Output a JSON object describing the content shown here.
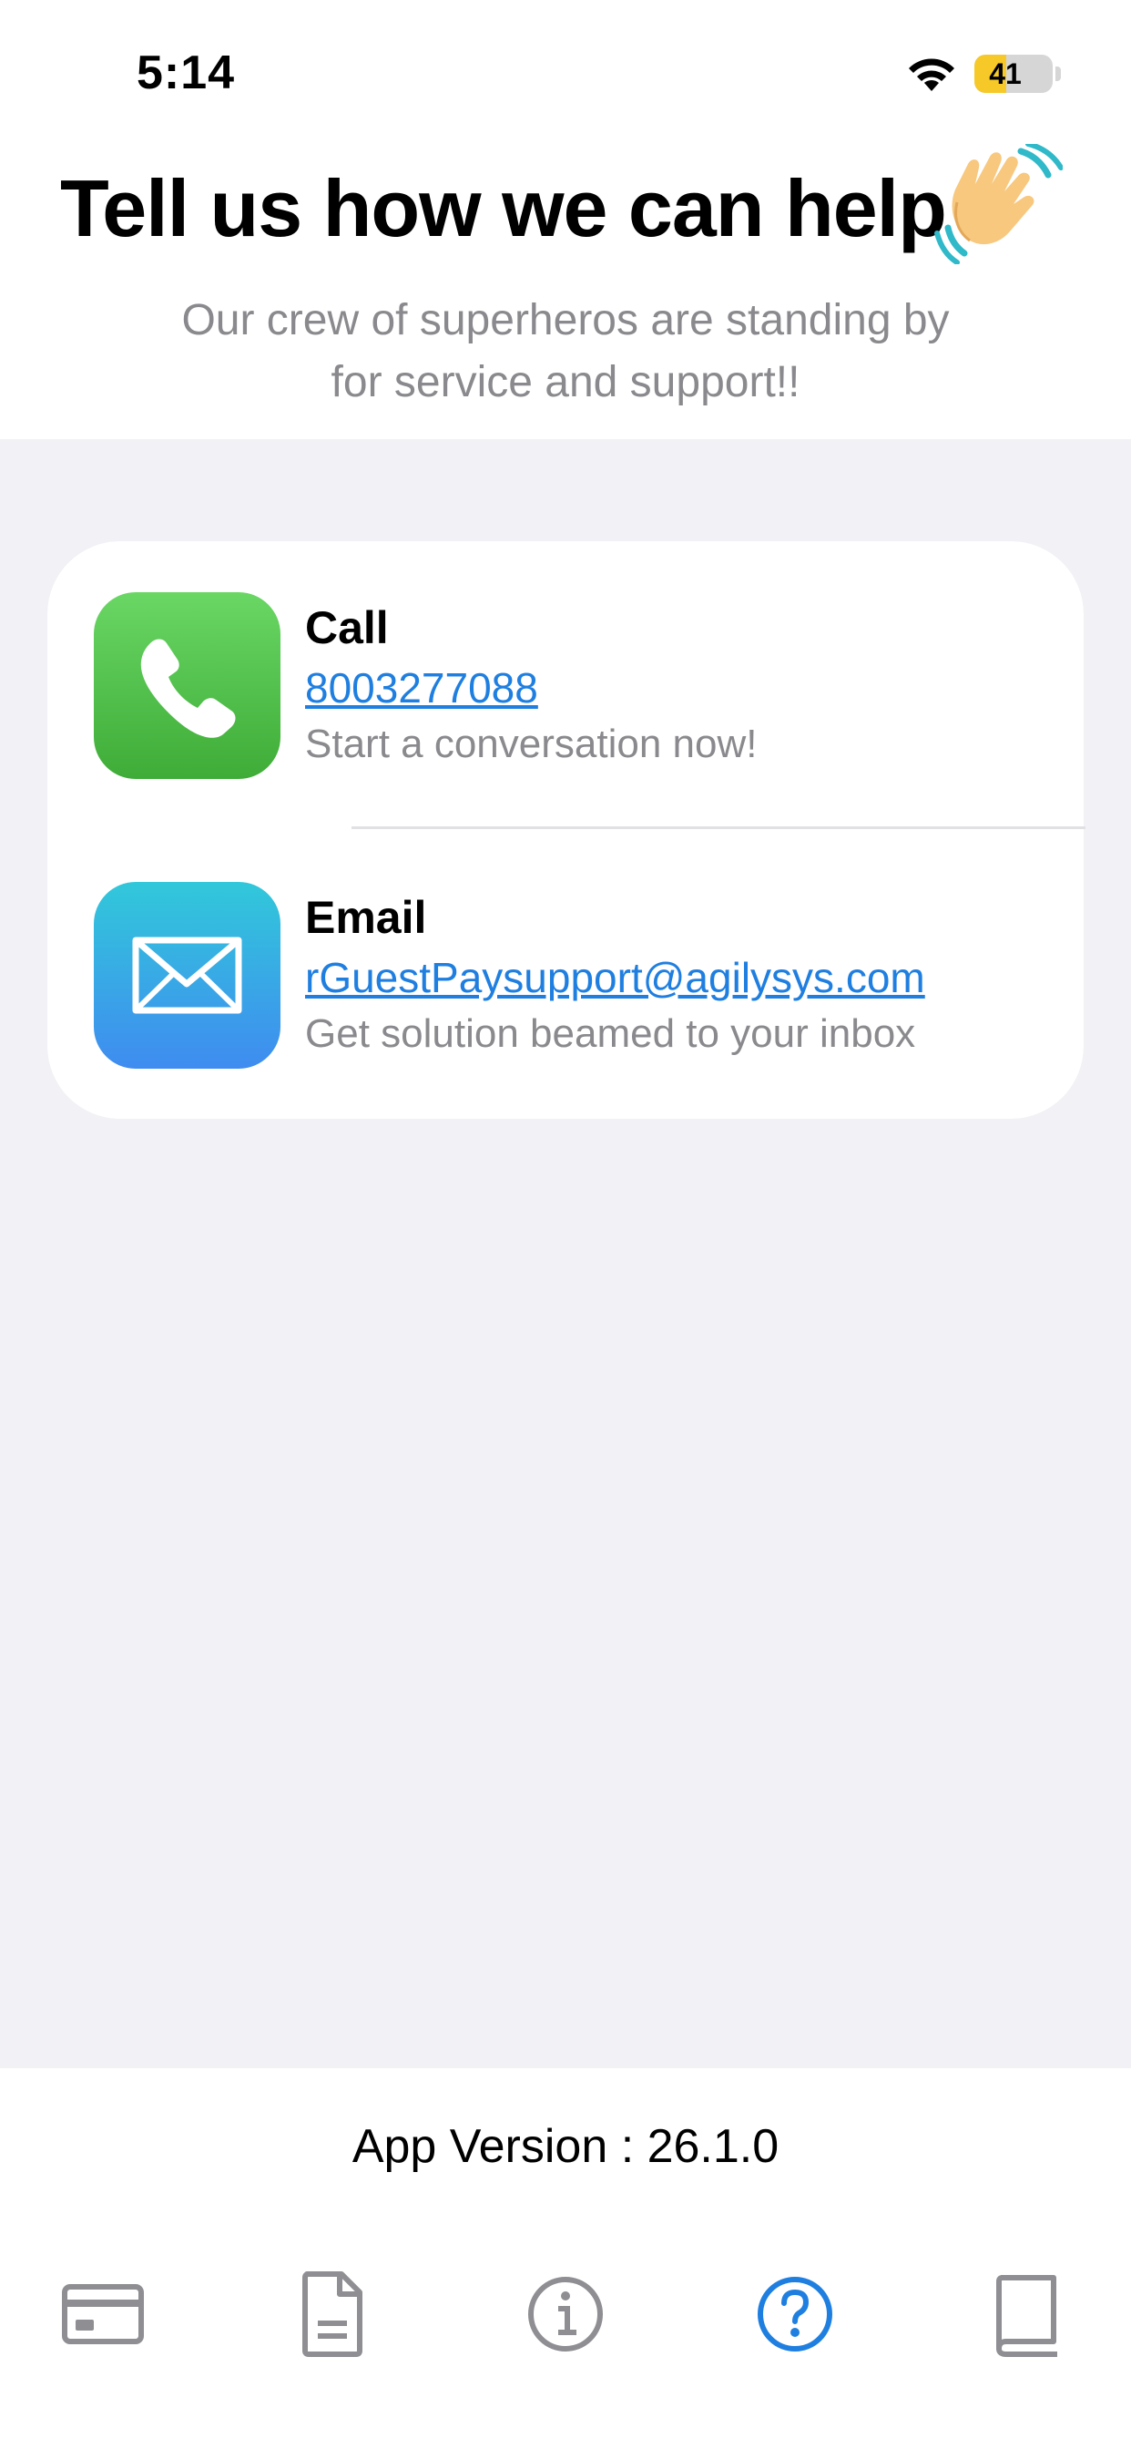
{
  "status_bar": {
    "time": "5:14",
    "battery_level": "41",
    "battery_fraction": 0.41,
    "icons": [
      "wifi-icon",
      "battery-icon"
    ]
  },
  "header": {
    "title": "Tell us how we can help",
    "title_emoji_icon": "waving-hand-icon",
    "subtitle": "Our crew of superheros are standing by\nfor service and support!!"
  },
  "contacts": [
    {
      "icon": "phone-icon",
      "title": "Call",
      "link": "8003277088",
      "description": "Start a conversation now!"
    },
    {
      "icon": "envelope-icon",
      "title": "Email",
      "link": "rGuestPaysupport@agilysys.com",
      "description": "Get solution beamed to your inbox"
    }
  ],
  "footer": {
    "app_version": "App Version : 26.1.0"
  },
  "tab_bar": {
    "items": [
      {
        "icon": "credit-card-icon",
        "active": false
      },
      {
        "icon": "document-icon",
        "active": false
      },
      {
        "icon": "info-icon",
        "active": false
      },
      {
        "icon": "help-icon",
        "active": true
      },
      {
        "icon": "book-icon",
        "active": false
      }
    ]
  },
  "colors": {
    "accent": "#1f7fe0",
    "inactive_tab": "#8e8e93",
    "background": "#f1f1f6",
    "battery": "#f6c928"
  }
}
